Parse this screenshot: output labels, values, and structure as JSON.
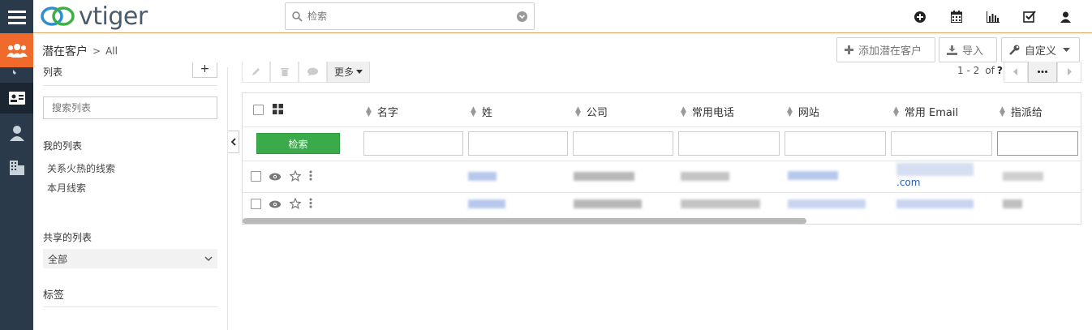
{
  "app": {
    "name": "vtiger"
  },
  "search": {
    "placeholder": "检索"
  },
  "breadcrumb": {
    "module": "潜在客户",
    "separator": ">",
    "view": "All"
  },
  "header_buttons": {
    "add": "添加潜在客户",
    "import": "导入",
    "customize": "自定义"
  },
  "sidebar": {
    "list_title": "列表",
    "search_placeholder": "搜索列表",
    "my_lists_title": "我的列表",
    "my_lists": [
      "关系火热的线索",
      "本月线索"
    ],
    "shared_lists_title": "共享的列表",
    "shared_select": "全部",
    "tags_title": "标签"
  },
  "toolbar": {
    "more": "更多"
  },
  "pager": {
    "range": "1 - 2",
    "of": "of",
    "total": "?"
  },
  "table": {
    "columns": [
      "名字",
      "姓",
      "公司",
      "常用电话",
      "网站",
      "常用 Email",
      "指派给"
    ],
    "search_button": "检索",
    "rows": [
      {
        "email_suffix": ".com"
      },
      {
        "email_suffix": ""
      }
    ]
  },
  "colors": {
    "accent": "#f06a2b",
    "sidebar_bg": "#2b3a4a",
    "search_btn": "#3aaa4a"
  }
}
